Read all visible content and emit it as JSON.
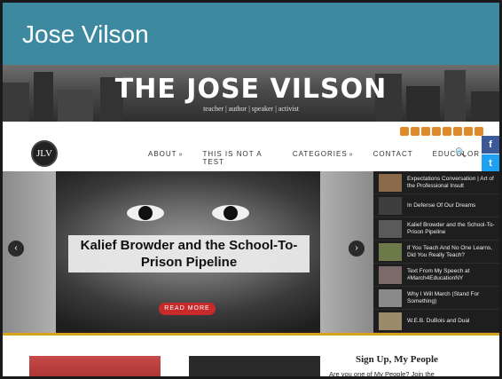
{
  "title_bar": {
    "title": "Jose Vilson"
  },
  "banner": {
    "brand": "THE JOSE VILSON",
    "tagline": "teacher | author | speaker | activist"
  },
  "logo": {
    "text": "JLV"
  },
  "nav": {
    "items": [
      {
        "label": "ABOUT",
        "chevron": true
      },
      {
        "label": "THIS IS NOT A TEST",
        "chevron": false
      },
      {
        "label": "CATEGORIES",
        "chevron": true
      },
      {
        "label": "CONTACT",
        "chevron": false
      },
      {
        "label": "EDUCOLOR",
        "chevron": false
      }
    ],
    "chevron_glyph": "»",
    "search_glyph": "🔍"
  },
  "share_buttons": [
    {
      "icon": "facebook-icon",
      "glyph": "f",
      "color": "#3b5998"
    },
    {
      "icon": "twitter-icon",
      "glyph": "t",
      "color": "#1da1f2"
    },
    {
      "icon": "print-icon",
      "glyph": "⎙",
      "color": "#7a8a8a"
    },
    {
      "icon": "email-icon",
      "glyph": "✉",
      "color": "#7a7a7a"
    },
    {
      "icon": "plus-icon",
      "glyph": "+",
      "color": "#ff6550"
    }
  ],
  "slider": {
    "caption": "Kalief Browder and the School-To-Prison Pipeline",
    "read_more": "READ MORE",
    "prev": "‹",
    "next": "›"
  },
  "posts": [
    {
      "title": "Expectations Conversation | Art of the Professional Insult"
    },
    {
      "title": "In Defense Of Our Dreams"
    },
    {
      "title": "Kalief Browder and the School-To-Prison Pipeline"
    },
    {
      "title": "If You Teach And No One Learns, Did You Really Teach?"
    },
    {
      "title": "Text From My Speech at #March4EducationNY"
    },
    {
      "title": "Why I Will March (Stand For Something)"
    },
    {
      "title": "W.E.B. DuBois and Dual"
    }
  ],
  "sidebar_widget": {
    "title": "Sign Up, My People",
    "text": "Are you one of My People? Join the"
  },
  "colors": {
    "header": "#3d8aa0",
    "accent": "#d8a21b",
    "read_more": "#c8292b",
    "social": "#e08a2a"
  }
}
